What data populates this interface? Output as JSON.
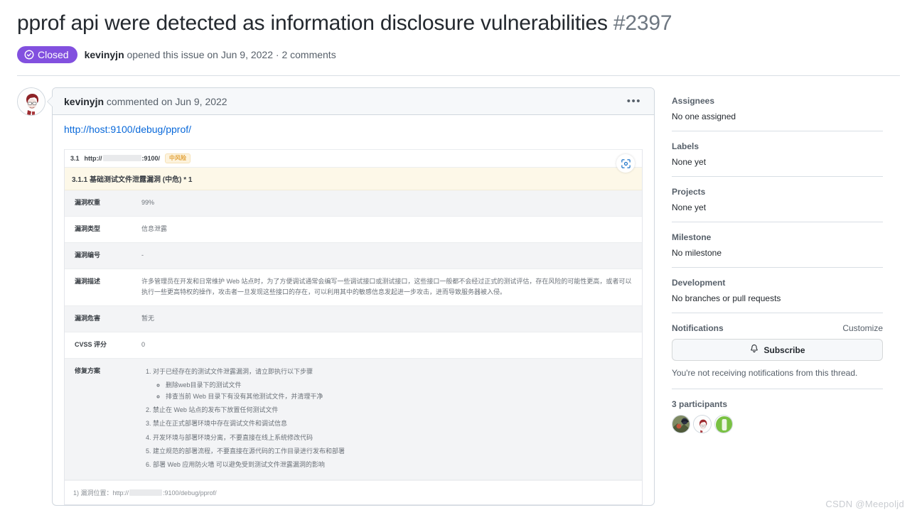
{
  "issue": {
    "title": "pprof api were detected as information disclosure vulnerabilities",
    "number": "#2397",
    "state": "Closed",
    "author": "kevinyjn",
    "meta_opened": "opened this issue on Jun 9, 2022 · 2 comments"
  },
  "comment": {
    "author": "kevinyjn",
    "action": "commented on Jun 9, 2022",
    "link": "http://host:9100/debug/pprof/",
    "menu_icon": "kebab-horizontal-icon"
  },
  "report": {
    "section_number": "3.1",
    "section_host_prefix": "http://",
    "section_port": ":9100/",
    "risk_badge": "中风险",
    "subsection": "3.1.1 基础测试文件泄露漏洞 (中危) * 1",
    "scan_icon": "scan-focus-icon",
    "rows": [
      {
        "key": "漏洞权重",
        "value": "99%"
      },
      {
        "key": "漏洞类型",
        "value": "信息泄露"
      },
      {
        "key": "漏洞编号",
        "value": "-"
      },
      {
        "key": "漏洞描述",
        "value": "许多管理员在开发和日常维护 Web 站点时，为了方便调试通常会编写一些调试接口或测试接口，这些接口一般都不会经过正式的测试评估，存在风险的可能性更高，或者可以执行一些更高特权的操作，攻击者一旦发现这些接口的存在，可以利用其中的敏感信息发起进一步攻击，进而导致服务器被入侵。"
      },
      {
        "key": "漏洞危害",
        "value": "暂无"
      },
      {
        "key": "CVSS 评分",
        "value": "0"
      }
    ],
    "fix_label": "修复方案",
    "fix_steps": [
      "对于已经存在的测试文件泄露漏洞，请立即执行以下步骤",
      "禁止在 Web 站点的发布下放置任何测试文件",
      "禁止在正式部署环境中存在调试文件和调试信息",
      "开发环境与部署环境分离，不要直接在线上系统修改代码",
      "建立规范的部署流程，不要直接在源代码的工作目录进行发布和部署",
      "部署 Web 应用防火墙 可以避免受到测试文件泄露漏洞的影响"
    ],
    "fix_substeps": [
      "删除web目录下的测试文件",
      "排查当前 Web 目录下有没有其他测试文件，并清理干净"
    ],
    "footer_prefix": "1) 漏洞位置：",
    "footer_url_start": "http://",
    "footer_url_end": ":9100/debug/pprof/"
  },
  "sidebar": {
    "sections": [
      {
        "label": "Assignees",
        "value": "No one assigned"
      },
      {
        "label": "Labels",
        "value": "None yet"
      },
      {
        "label": "Projects",
        "value": "None yet"
      },
      {
        "label": "Milestone",
        "value": "No milestone"
      },
      {
        "label": "Development",
        "value": "No branches or pull requests"
      }
    ],
    "notifications": {
      "label": "Notifications",
      "customize": "Customize",
      "subscribe_label": "Subscribe",
      "bell_icon": "bell-icon",
      "note": "You're not receiving notifications from this thread."
    },
    "participants": {
      "title": "3 participants",
      "avatars": [
        "participant-avatar-1",
        "participant-avatar-2",
        "participant-avatar-3"
      ]
    }
  },
  "watermark": "CSDN @Meepoljd",
  "colors": {
    "closed_purple": "#8250df",
    "link_blue": "#0969da",
    "risk_orange": "#e2a33c",
    "border_gray": "#d0d7de"
  }
}
